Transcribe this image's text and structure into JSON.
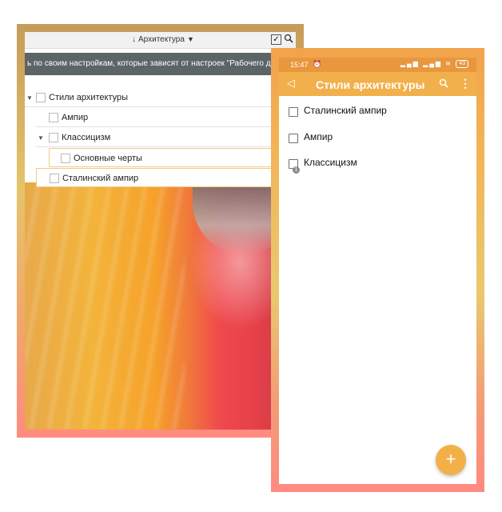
{
  "desktop": {
    "toolbar": {
      "title_arrow": "↓",
      "title": "Архитектура",
      "caret": "▼",
      "check": "✓"
    },
    "banner": "ь по своим настройкам, которые зависят от настроек \"Рабочего дн",
    "tree": [
      {
        "label": "Стили архитектуры",
        "toggle": "▼"
      },
      {
        "label": "Ампир",
        "toggle": ""
      },
      {
        "label": "Классицизм",
        "toggle": "▼"
      },
      {
        "label": "Основные черты",
        "toggle": ""
      },
      {
        "label": "Сталинский ампир",
        "toggle": ""
      }
    ]
  },
  "mobile": {
    "status": {
      "time": "15:47",
      "alarm": "⏰",
      "signal": "▂▄▆ ▂▄▆ ≋",
      "battery": "43"
    },
    "appbar": {
      "back": "◁",
      "title": "Стили архитектуры",
      "more": "⋮"
    },
    "items": [
      {
        "label": "Сталинский ампир",
        "badge": ""
      },
      {
        "label": "Ампир",
        "badge": ""
      },
      {
        "label": "Классицизм",
        "badge": "1"
      }
    ],
    "fab": "+"
  },
  "colors": {
    "accent_orange": "#f2b04c",
    "status_bar": "#e9973e",
    "banner_gray": "#5d6468",
    "frame_coral": "#ff8a80"
  },
  "icons": [
    "search-icon",
    "check-icon",
    "back-icon",
    "more-icon",
    "alarm-icon",
    "wifi-icon",
    "battery-icon",
    "add-icon"
  ]
}
